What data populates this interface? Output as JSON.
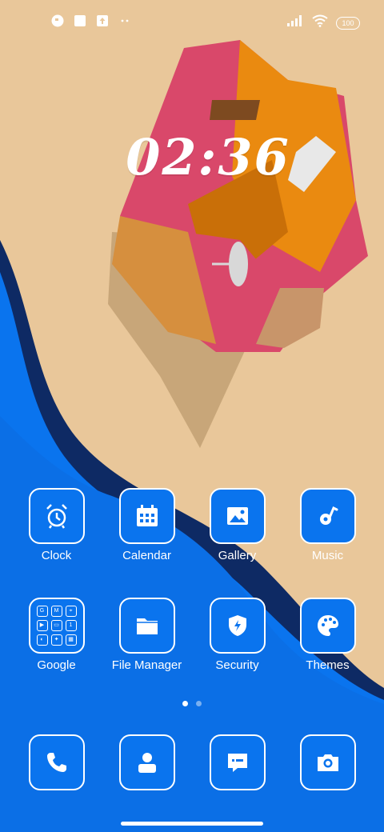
{
  "status_bar": {
    "battery": "100",
    "left_icons": [
      "app-notification-icon",
      "square-notification-icon",
      "upload-notification-icon",
      "more-dots-icon"
    ],
    "right_icons": [
      "signal-icon",
      "wifi-icon",
      "battery-icon"
    ]
  },
  "clock_widget": {
    "time": "02:36"
  },
  "apps": [
    {
      "label": "Clock",
      "icon": "alarm-clock-icon"
    },
    {
      "label": "Calendar",
      "icon": "calendar-icon"
    },
    {
      "label": "Gallery",
      "icon": "image-icon"
    },
    {
      "label": "Music",
      "icon": "music-note-icon"
    },
    {
      "label": "Google",
      "icon": "folder-grid-icon"
    },
    {
      "label": "File Manager",
      "icon": "folder-icon"
    },
    {
      "label": "Security",
      "icon": "shield-bolt-icon"
    },
    {
      "label": "Themes",
      "icon": "palette-icon"
    }
  ],
  "google_folder": {
    "mini_apps": [
      "G",
      "M",
      "⌖",
      "▶",
      "▭",
      "1",
      "◐",
      "✦",
      "▦"
    ]
  },
  "page_indicator": {
    "count": 2,
    "active": 1
  },
  "dock": [
    {
      "label": "Phone",
      "icon": "phone-icon"
    },
    {
      "label": "Contacts",
      "icon": "contact-icon"
    },
    {
      "label": "Messages",
      "icon": "message-icon"
    },
    {
      "label": "Camera",
      "icon": "camera-icon"
    }
  ],
  "colors": {
    "wallpaper_sand": "#e9c79a",
    "wave_blue": "#0a74ee",
    "wave_navy": "#0e2a64",
    "house_pink": "#d9486a",
    "house_orange": "#ea8a10"
  }
}
